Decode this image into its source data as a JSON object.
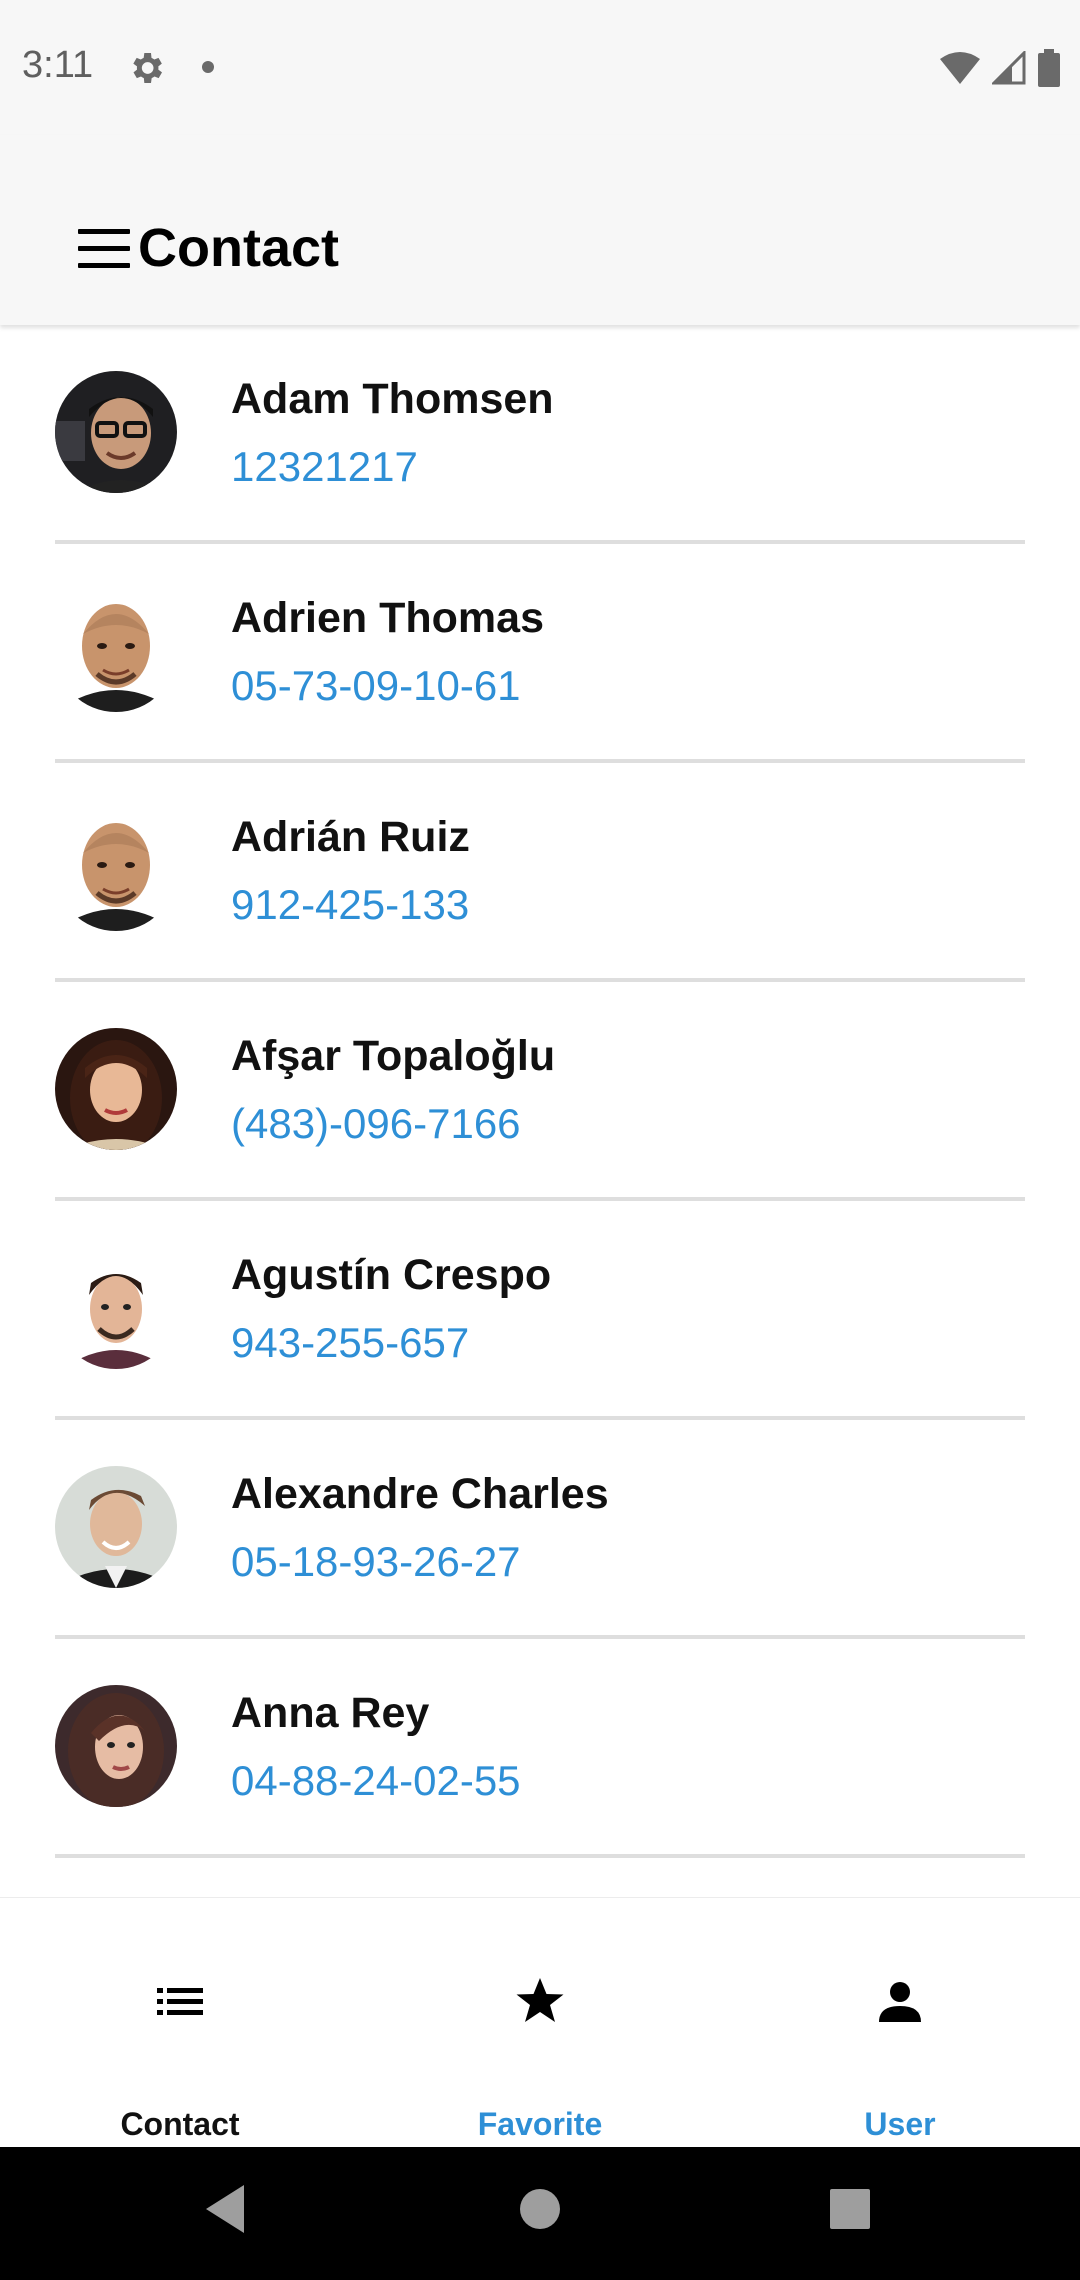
{
  "status_bar": {
    "time": "3:11",
    "icons": [
      "gear-icon",
      "notification-dot-icon",
      "wifi-icon",
      "cell-signal-icon",
      "battery-icon"
    ]
  },
  "app_bar": {
    "title": "Contact",
    "menu_icon": "hamburger-menu-icon"
  },
  "contacts": [
    {
      "name": "Adam Thomsen",
      "phone": "12321217"
    },
    {
      "name": "Adrien Thomas",
      "phone": "05-73-09-10-61"
    },
    {
      "name": "Adrián Ruiz",
      "phone": "912-425-133"
    },
    {
      "name": "Afşar Topaloğlu",
      "phone": "(483)-096-7166"
    },
    {
      "name": "Agustín Crespo",
      "phone": "943-255-657"
    },
    {
      "name": "Alexandre Charles",
      "phone": "05-18-93-26-27"
    },
    {
      "name": "Anna Rey",
      "phone": "04-88-24-02-55"
    }
  ],
  "bottom_nav": {
    "tabs": [
      {
        "label": "Contact",
        "icon": "list-icon",
        "active": true
      },
      {
        "label": "Favorite",
        "icon": "star-icon",
        "active": false
      },
      {
        "label": "User",
        "icon": "person-icon",
        "active": false
      }
    ]
  },
  "system_nav": {
    "icons": [
      "back-icon",
      "home-icon",
      "recents-icon"
    ]
  },
  "colors": {
    "accent": "#2e8fd6",
    "app_bar_bg": "#f7f7f7",
    "divider": "#dedede",
    "text_primary": "#111111",
    "system_nav_bg": "#000000"
  }
}
